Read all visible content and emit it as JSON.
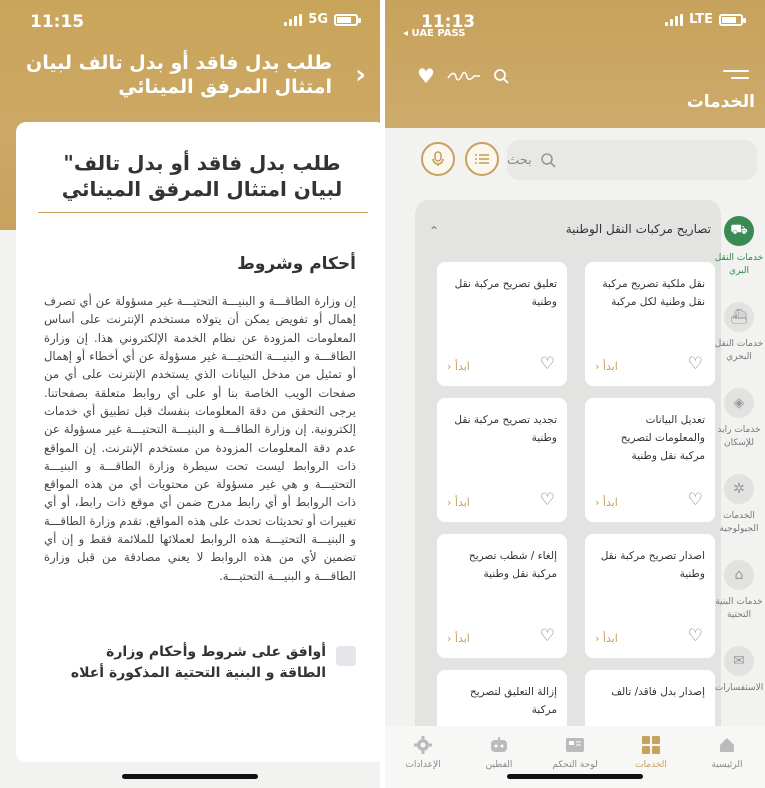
{
  "left": {
    "status": {
      "time": "11:15",
      "network": "5G"
    },
    "header_title": "طلب بدل فاقد أو بدل تالف لبيان امتثال المرفق المينائي",
    "card_title": "طلب بدل فاقد أو بدل تالف\" لبيان امتثال المرفق المينائي",
    "terms_heading": "أحكام وشروط",
    "terms_body": "إن وزارة الطاقـــة و البنيـــة التحتيـــة غير مسؤولة عن أي تصرف إهمال أو تفويض يمكن أن يتولاه مستخدم الإنترنت على أساس المعلومات المزودة عن نظام الخدمة الإلكتروني هذا. إن وزارة الطاقـــة و البنيـــة التحتيـــة غير مسؤولة عن أي أخطاء أو إهمال أو تمثيل من مدخل البيانات الذي يستخدم الإنترنت على أي من صفحات الويب الخاصة بنا أو على أي روابط متعلقة بصفحاتنا. يرجى التحقق من دقة المعلومات بنفسك قبل تطبيق أي خدمات إلكترونية. إن وزارة الطاقـــة و البنيـــة التحتيـــة غير مسؤولة عن عدم دقة المعلومات المزودة من مستخدم الإنترنت. إن المواقع ذات الروابط ليست تحت سيطرة وزارة الطاقـــة و البنيـــة التحتيـــة و هي غير مسؤولة عن محتويات أي من هذه المواقع ذات الروابط أو أي رابط مدرج ضمن أي موقع ذات رابط، أو أي تغييرات أو تحديثات تحدث على هذه المواقع. تقدم وزارة الطاقـــة و البنيـــة التحتيـــة هذه الروابط لعملائها للملائمة فقط و إن أي تضمين لأي من هذه الروابط لا يعني مصادقة من قبل وزارة الطاقـــة و البنيـــة التحتيـــة.",
    "agree_label": "أوافق على شروط وأحكام وزارة الطاقة و البنية التحتية المذكورة أعلاه"
  },
  "right": {
    "status": {
      "time": "11:13",
      "network": "LTE",
      "back_app": "◂ UAE PASS"
    },
    "page_title": "الخدمات",
    "search_placeholder": "بحث",
    "category_title": "تصاريح مركبات النقل الوطنية",
    "side_nav": [
      {
        "label": "خدمات النقل البري",
        "icon": "truck-icon",
        "glyph": "⛟",
        "active": true
      },
      {
        "label": "خدمات النقل البحري",
        "icon": "ship-icon",
        "glyph": "⛴",
        "active": false
      },
      {
        "label": "خدمات رايد للإسكان",
        "icon": "housing-icon",
        "glyph": "◈",
        "active": false
      },
      {
        "label": "الخدمات الجيولوجية",
        "icon": "geology-icon",
        "glyph": "✲",
        "active": false
      },
      {
        "label": "خدمات البنية التحتية",
        "icon": "infrastructure-icon",
        "glyph": "⌂",
        "active": false
      },
      {
        "label": "الاستفسارات",
        "icon": "inquiries-icon",
        "glyph": "✉",
        "active": false
      }
    ],
    "tiles": [
      {
        "label": "نقل ملكية تصريح مركبة نقل وطنية لكل مركبة",
        "start": "ابدأ"
      },
      {
        "label": "تعليق تصريح مركبة نقل وطنية",
        "start": "ابدأ"
      },
      {
        "label": "تعديل البيانات والمعلومات لتصريح مركبة نقل وطنية",
        "start": "ابدأ"
      },
      {
        "label": "تجديد تصريح مركبة نقل وطنية",
        "start": "ابدأ"
      },
      {
        "label": "اصدار تصريح مركبة نقل وطنية",
        "start": "ابدأ"
      },
      {
        "label": "إلغاء / شطب تصريح مركبة نقل وطنية",
        "start": "ابدأ"
      },
      {
        "label": "إصدار بدل فاقد/ تالف",
        "start": ""
      },
      {
        "label": "إزالة التعليق لتصريح مركبة",
        "start": ""
      }
    ],
    "tabs": [
      {
        "label": "الرئيسية",
        "icon": "home-icon",
        "active": false
      },
      {
        "label": "الخدمات",
        "icon": "services-grid-icon",
        "active": true
      },
      {
        "label": "لوحة التحكم",
        "icon": "dashboard-icon",
        "active": false
      },
      {
        "label": "الفطين",
        "icon": "chatbot-icon",
        "active": false
      },
      {
        "label": "الإعدادات",
        "icon": "settings-icon",
        "active": false
      }
    ],
    "colors": {
      "gold": "#c7a25d",
      "green": "#3a8a54"
    }
  }
}
